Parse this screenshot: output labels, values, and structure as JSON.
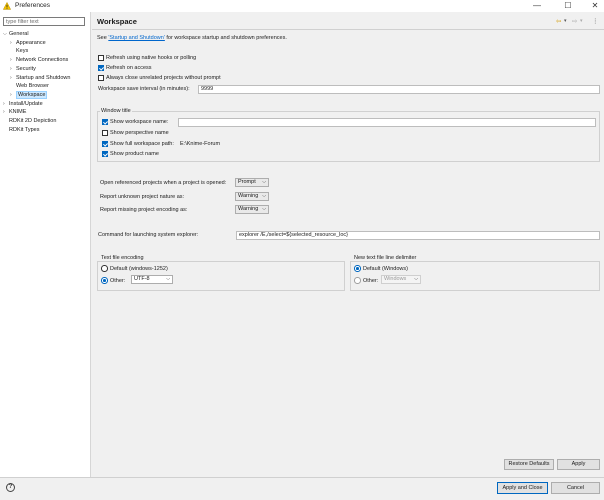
{
  "window": {
    "title": "Preferences",
    "controls": {
      "minimize": "—",
      "maximize": "☐",
      "close": "✕"
    }
  },
  "sidebar": {
    "filter_placeholder": "type filter text",
    "tree": [
      {
        "label": "General",
        "arrow": "⌵",
        "level": 0,
        "expanded": true
      },
      {
        "label": "Appearance",
        "arrow": "›",
        "level": 1
      },
      {
        "label": "Keys",
        "arrow": "",
        "level": 1
      },
      {
        "label": "Network Connections",
        "arrow": "›",
        "level": 1
      },
      {
        "label": "Security",
        "arrow": "›",
        "level": 1
      },
      {
        "label": "Startup and Shutdown",
        "arrow": "›",
        "level": 1
      },
      {
        "label": "Web Browser",
        "arrow": "",
        "level": 1
      },
      {
        "label": "Workspace",
        "arrow": "›",
        "level": 1,
        "selected": true
      },
      {
        "label": "Install/Update",
        "arrow": "›",
        "level": 0
      },
      {
        "label": "KNIME",
        "arrow": "›",
        "level": 0
      },
      {
        "label": "RDKit 2D Depiction",
        "arrow": "",
        "level": 0
      },
      {
        "label": "RDKit Types",
        "arrow": "",
        "level": 0
      }
    ]
  },
  "header": {
    "title": "Workspace",
    "nav": {
      "back": "⇦",
      "back_menu": "▾",
      "forward": "⇨",
      "forward_menu": "▾",
      "menu": "⋮"
    }
  },
  "content": {
    "intro_prefix": "See ",
    "intro_link": "'Startup and Shutdown'",
    "intro_suffix": " for workspace startup and shutdown preferences.",
    "refresh_native": {
      "label": "Refresh using native hooks or polling",
      "checked": false
    },
    "refresh_access": {
      "label": "Refresh on access",
      "checked": true
    },
    "close_unrelated": {
      "label": "Always close unrelated projects without prompt",
      "checked": false
    },
    "save_interval": {
      "label": "Workspace save interval (in minutes):",
      "value": "9999"
    },
    "window_title": {
      "group_label": "Window title",
      "show_workspace_name": {
        "label": "Show workspace name:",
        "checked": true,
        "value": ""
      },
      "show_perspective_name": {
        "label": "Show perspective name",
        "checked": false
      },
      "show_full_path": {
        "label": "Show full workspace path:",
        "checked": true,
        "value": "E:\\Knime-Forum"
      },
      "show_product_name": {
        "label": "Show product name",
        "checked": true
      }
    },
    "open_referenced": {
      "label": "Open referenced projects when a project is opened:",
      "value": "Prompt"
    },
    "unknown_nature": {
      "label": "Report unknown project nature as:",
      "value": "Warning"
    },
    "missing_encoding": {
      "label": "Report missing project encoding as:",
      "value": "Warning"
    },
    "system_explorer": {
      "label": "Command for launching system explorer:",
      "value": "explorer /E,/select=${selected_resource_loc}"
    },
    "text_encoding": {
      "group_label": "Text file encoding",
      "default_label": "Default (windows-1252)",
      "other_label": "Other:",
      "other_value": "UTF-8",
      "selected": "other"
    },
    "line_delimiter": {
      "group_label": "New text file line delimiter",
      "default_label": "Default (Windows)",
      "other_label": "Other:",
      "other_value": "Windows",
      "selected": "default"
    }
  },
  "buttons": {
    "restore_defaults": "Restore Defaults",
    "apply": "Apply",
    "apply_and_close": "Apply and Close",
    "cancel": "Cancel"
  },
  "help_icon": "?",
  "colors": {
    "accent": "#0067c0",
    "link": "#0066cc",
    "selection": "#cce8ff"
  }
}
